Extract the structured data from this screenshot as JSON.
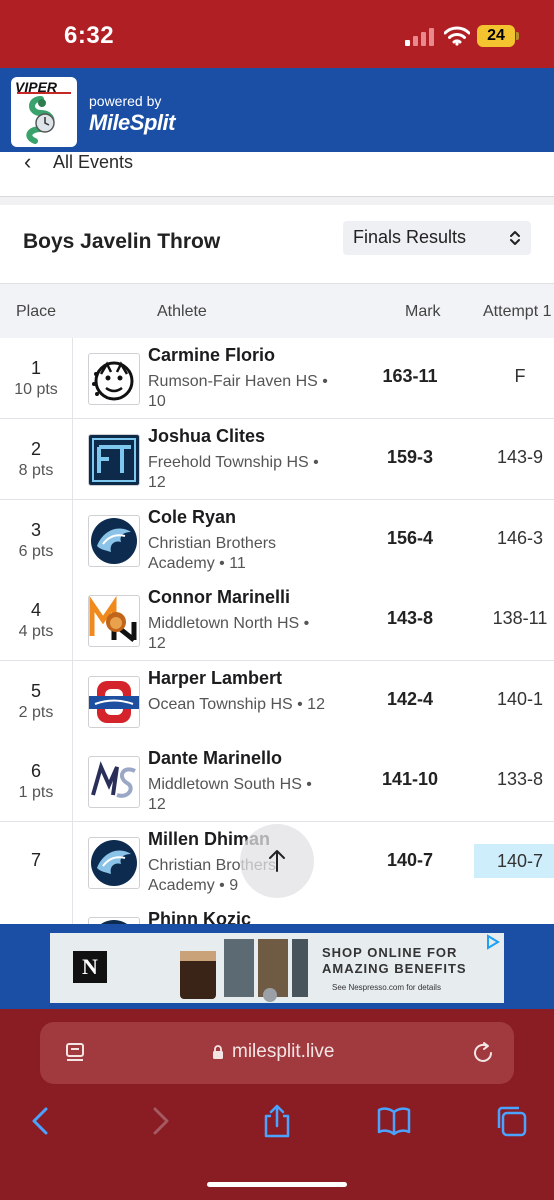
{
  "status": {
    "time": "6:32",
    "battery": "24"
  },
  "header": {
    "logo_text": "VIPER",
    "powered_by": "powered by",
    "brand": "MileSplit"
  },
  "nav": {
    "back_label": "All Events"
  },
  "event": {
    "title": "Boys Javelin Throw",
    "view_select": "Finals Results"
  },
  "table": {
    "columns": {
      "place": "Place",
      "athlete": "Athlete",
      "mark": "Mark",
      "attempt1": "Attempt 1"
    },
    "rows": [
      {
        "place": "1",
        "pts": "10 pts",
        "name": "Carmine Florio",
        "team": "Rumson-Fair Haven HS • 10",
        "mark": "163-11",
        "attempt1": "F",
        "logo": "bulldog-logo"
      },
      {
        "place": "2",
        "pts": "8 pts",
        "name": "Joshua Clites",
        "team": "Freehold Township HS • 12",
        "mark": "159-3",
        "attempt1": "143-9",
        "logo": "ft-logo"
      },
      {
        "place": "3",
        "pts": "6 pts",
        "name": "Cole Ryan",
        "team": "Christian Brothers Academy • 11",
        "mark": "156-4",
        "attempt1": "146-3",
        "logo": "colt-logo"
      },
      {
        "place": "4",
        "pts": "4 pts",
        "name": "Connor Marinelli",
        "team": "Middletown North HS • 12",
        "mark": "143-8",
        "attempt1": "138-11",
        "logo": "lion-logo"
      },
      {
        "place": "5",
        "pts": "2 pts",
        "name": "Harper Lambert",
        "team": "Ocean Township HS • 12",
        "mark": "142-4",
        "attempt1": "140-1",
        "logo": "spartans-logo"
      },
      {
        "place": "6",
        "pts": "1 pts",
        "name": "Dante Marinello",
        "team": "Middletown South HS • 12",
        "mark": "141-10",
        "attempt1": "133-8",
        "logo": "ms-logo"
      },
      {
        "place": "7",
        "pts": "",
        "name": "Millen Dhiman",
        "team": "Christian Brothers Academy • 9",
        "mark": "140-7",
        "attempt1": "140-7",
        "logo": "colt-logo"
      },
      {
        "place": "",
        "pts": "",
        "name": "Phinn Kozic",
        "team": "",
        "mark": "",
        "attempt1": "",
        "logo": "colt-logo"
      }
    ]
  },
  "ad": {
    "line1": "SHOP ONLINE FOR",
    "line2": "AMAZING BENEFITS",
    "line3": "See Nespresso.com for details",
    "brand_letter": "N"
  },
  "browser": {
    "url": "milesplit.live"
  },
  "colors": {
    "status_bar": "#b01f24",
    "header": "#1b4fa6",
    "chrome": "#8a1c24",
    "highlight": "#cfeefc"
  }
}
